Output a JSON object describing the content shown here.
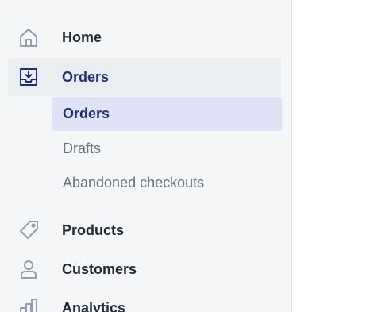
{
  "sidebar": {
    "items": [
      {
        "label": "Home",
        "icon": "home-icon"
      },
      {
        "label": "Orders",
        "icon": "orders-inbox-icon",
        "active": true
      },
      {
        "label": "Products",
        "icon": "tag-icon"
      },
      {
        "label": "Customers",
        "icon": "person-icon"
      },
      {
        "label": "Analytics",
        "icon": "bar-chart-icon"
      }
    ],
    "orders_subitems": [
      {
        "label": "Orders",
        "selected": true
      },
      {
        "label": "Drafts"
      },
      {
        "label": "Abandoned checkouts"
      }
    ]
  },
  "colors": {
    "sidebar_bg": "#f4f6f8",
    "active_bg": "#ebeef0",
    "selected_sub_bg": "#dfe3f5",
    "accent_indigo": "#202e78",
    "text_primary": "#212b36",
    "text_secondary": "#637381",
    "icon_color": "#919eab"
  }
}
